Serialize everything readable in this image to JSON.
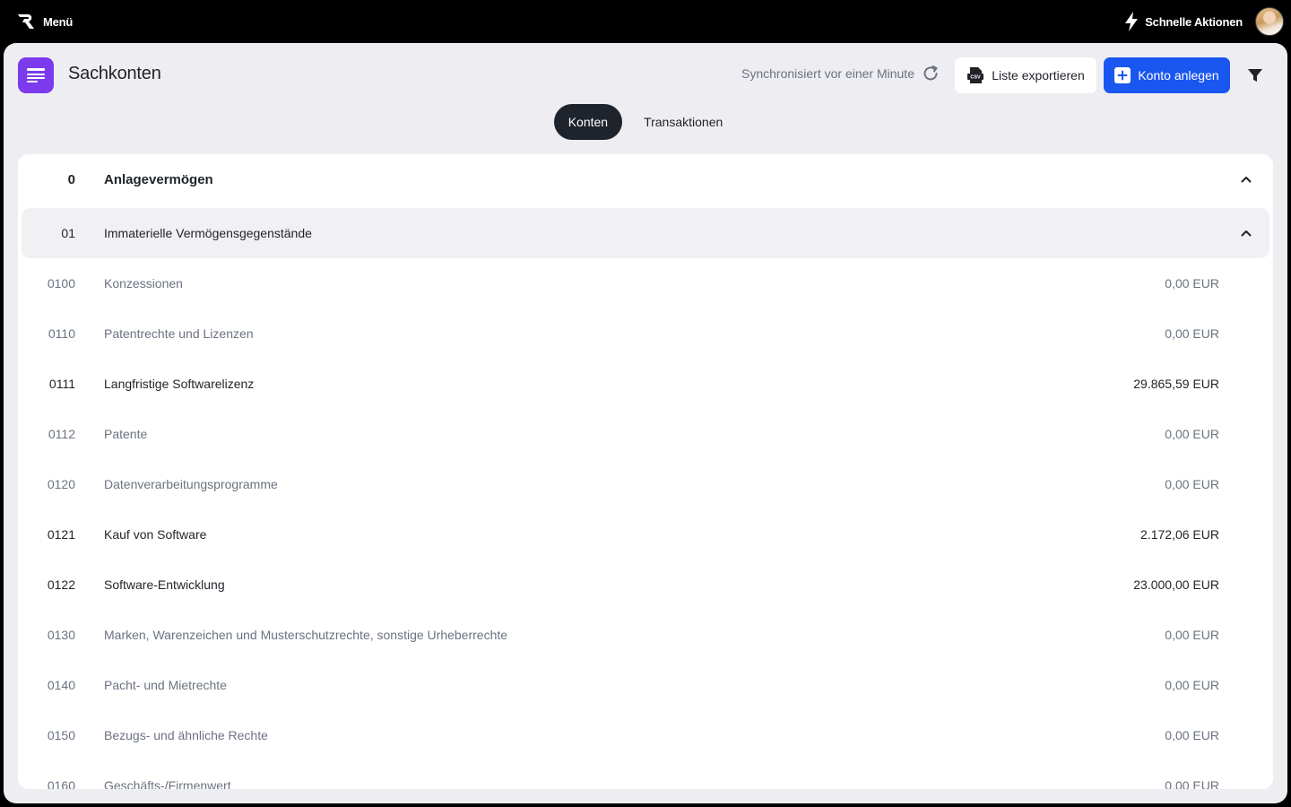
{
  "topbar": {
    "menu_label": "Menü",
    "quick_actions_label": "Schnelle Aktionen"
  },
  "header": {
    "title": "Sachkonten",
    "sync_text": "Synchronisiert vor einer Minute",
    "export_label": "Liste exportieren",
    "create_label": "Konto anlegen"
  },
  "tabs": [
    {
      "label": "Konten",
      "active": true
    },
    {
      "label": "Transaktionen",
      "active": false
    }
  ],
  "group": {
    "number": "0",
    "label": "Anlagevermögen"
  },
  "subgroup": {
    "number": "01",
    "label": "Immaterielle Vermögensgegenstände"
  },
  "accounts": [
    {
      "number": "0100",
      "label": "Konzessionen",
      "amount": "0,00 EUR",
      "has_value": false
    },
    {
      "number": "0110",
      "label": "Patentrechte und Lizenzen",
      "amount": "0,00 EUR",
      "has_value": false
    },
    {
      "number": "0111",
      "label": "Langfristige Softwarelizenz",
      "amount": "29.865,59 EUR",
      "has_value": true
    },
    {
      "number": "0112",
      "label": "Patente",
      "amount": "0,00 EUR",
      "has_value": false
    },
    {
      "number": "0120",
      "label": "Datenverarbeitungsprogramme",
      "amount": "0,00 EUR",
      "has_value": false
    },
    {
      "number": "0121",
      "label": "Kauf von Software",
      "amount": "2.172,06 EUR",
      "has_value": true
    },
    {
      "number": "0122",
      "label": "Software-Entwicklung",
      "amount": "23.000,00 EUR",
      "has_value": true
    },
    {
      "number": "0130",
      "label": "Marken, Warenzeichen und Musterschutzrechte, sonstige Urheberrechte",
      "amount": "0,00 EUR",
      "has_value": false
    },
    {
      "number": "0140",
      "label": "Pacht- und Mietrechte",
      "amount": "0,00 EUR",
      "has_value": false
    },
    {
      "number": "0150",
      "label": "Bezugs- und ähnliche Rechte",
      "amount": "0,00 EUR",
      "has_value": false
    },
    {
      "number": "0160",
      "label": "Geschäfts-/Firmenwert",
      "amount": "0,00 EUR",
      "has_value": false
    }
  ],
  "colors": {
    "accent_blue": "#1a56f0",
    "app_icon_purple": "#7c3aed",
    "active_tab": "#1f232b"
  },
  "icons": {
    "logo": "r-logo-icon",
    "quick_actions": "lightning-icon",
    "app": "list-icon",
    "sync": "refresh-icon",
    "export": "csv-icon",
    "create": "plus-icon",
    "filter": "filter-icon",
    "collapse": "chevron-up-icon"
  }
}
